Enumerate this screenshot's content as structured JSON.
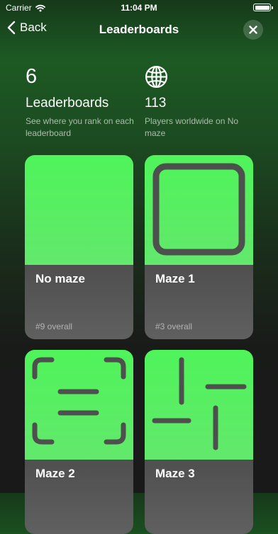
{
  "status_bar": {
    "carrier": "Carrier",
    "time": "11:04 PM"
  },
  "nav": {
    "back_label": "Back",
    "title": "Leaderboards"
  },
  "stats": [
    {
      "value": "6",
      "icon": "none",
      "title": "Leaderboards",
      "subtitle": "See where you rank on each leaderboard"
    },
    {
      "icon": "globe-icon",
      "value": "113",
      "subtitle": "Players worldwide on No maze"
    }
  ],
  "cards": [
    {
      "name": "No maze",
      "rank": "#9 overall",
      "icon": "none"
    },
    {
      "name": "Maze 1",
      "rank": "#3 overall",
      "icon": "maze-square-icon"
    },
    {
      "name": "Maze 2",
      "rank": "",
      "icon": "maze-corners-icon"
    },
    {
      "name": "Maze 3",
      "rank": "",
      "icon": "maze-bars-icon"
    }
  ],
  "colors": {
    "card_green": "#4ff45a",
    "maze_wall": "#4d514d",
    "card_bottom": "#444444"
  }
}
